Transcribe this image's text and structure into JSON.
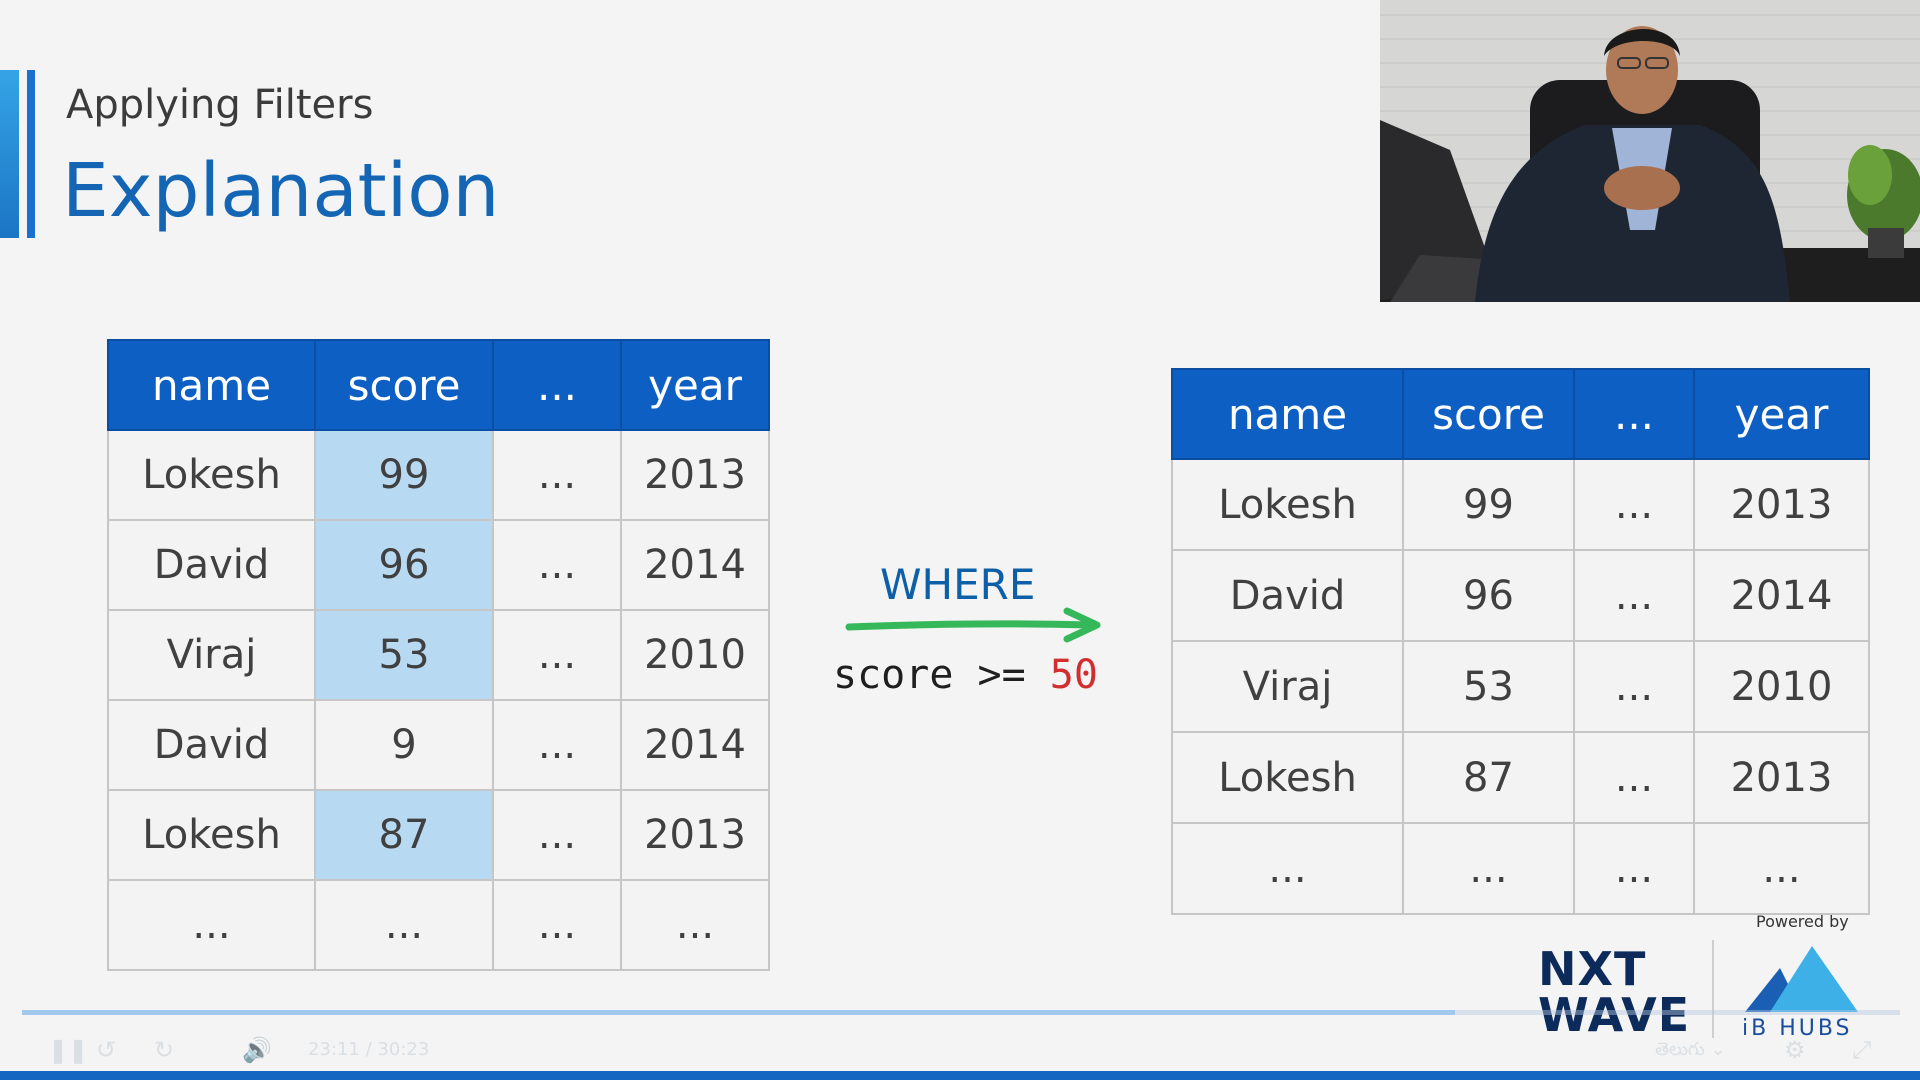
{
  "header": {
    "subtitle": "Applying Filters",
    "title": "Explanation"
  },
  "left_table": {
    "columns": [
      "name",
      "score",
      "...",
      "year"
    ],
    "rows": [
      [
        "Lokesh",
        "99",
        "...",
        "2013"
      ],
      [
        "David",
        "96",
        "...",
        "2014"
      ],
      [
        "Viraj",
        "53",
        "...",
        "2010"
      ],
      [
        "David",
        "9",
        "...",
        "2014"
      ],
      [
        "Lokesh",
        "87",
        "...",
        "2013"
      ],
      [
        "...",
        "...",
        "...",
        "..."
      ]
    ],
    "highlighted_rows": [
      0,
      1,
      2,
      4
    ]
  },
  "filter": {
    "keyword": "WHERE",
    "condition_prefix": "score >= ",
    "condition_value": "50"
  },
  "right_table": {
    "columns": [
      "name",
      "score",
      "...",
      "year"
    ],
    "rows": [
      [
        "Lokesh",
        "99",
        "...",
        "2013"
      ],
      [
        "David",
        "96",
        "...",
        "2014"
      ],
      [
        "Viraj",
        "53",
        "...",
        "2010"
      ],
      [
        "Lokesh",
        "87",
        "...",
        "2013"
      ],
      [
        "...",
        "...",
        "...",
        "..."
      ]
    ]
  },
  "branding": {
    "powered_by": "Powered by",
    "nxtwave_line1": "NXT",
    "nxtwave_line2": "WAVE",
    "ibhubs": "iB HUBS"
  },
  "player": {
    "current_time": "23:11",
    "separator": "/",
    "duration": "30:23",
    "progress_fraction": 0.763,
    "language": "తెలుగు",
    "icons": [
      "pause-icon",
      "rewind-icon",
      "forward-icon",
      "volume-icon",
      "settings-icon",
      "fullscreen-icon"
    ]
  },
  "colors": {
    "header_blue": "#0d5fc4",
    "highlight_blue": "#b8d9f2",
    "title_blue": "#1466b5",
    "arrow_green": "#35b85a",
    "condition_red": "#d12f2f"
  }
}
